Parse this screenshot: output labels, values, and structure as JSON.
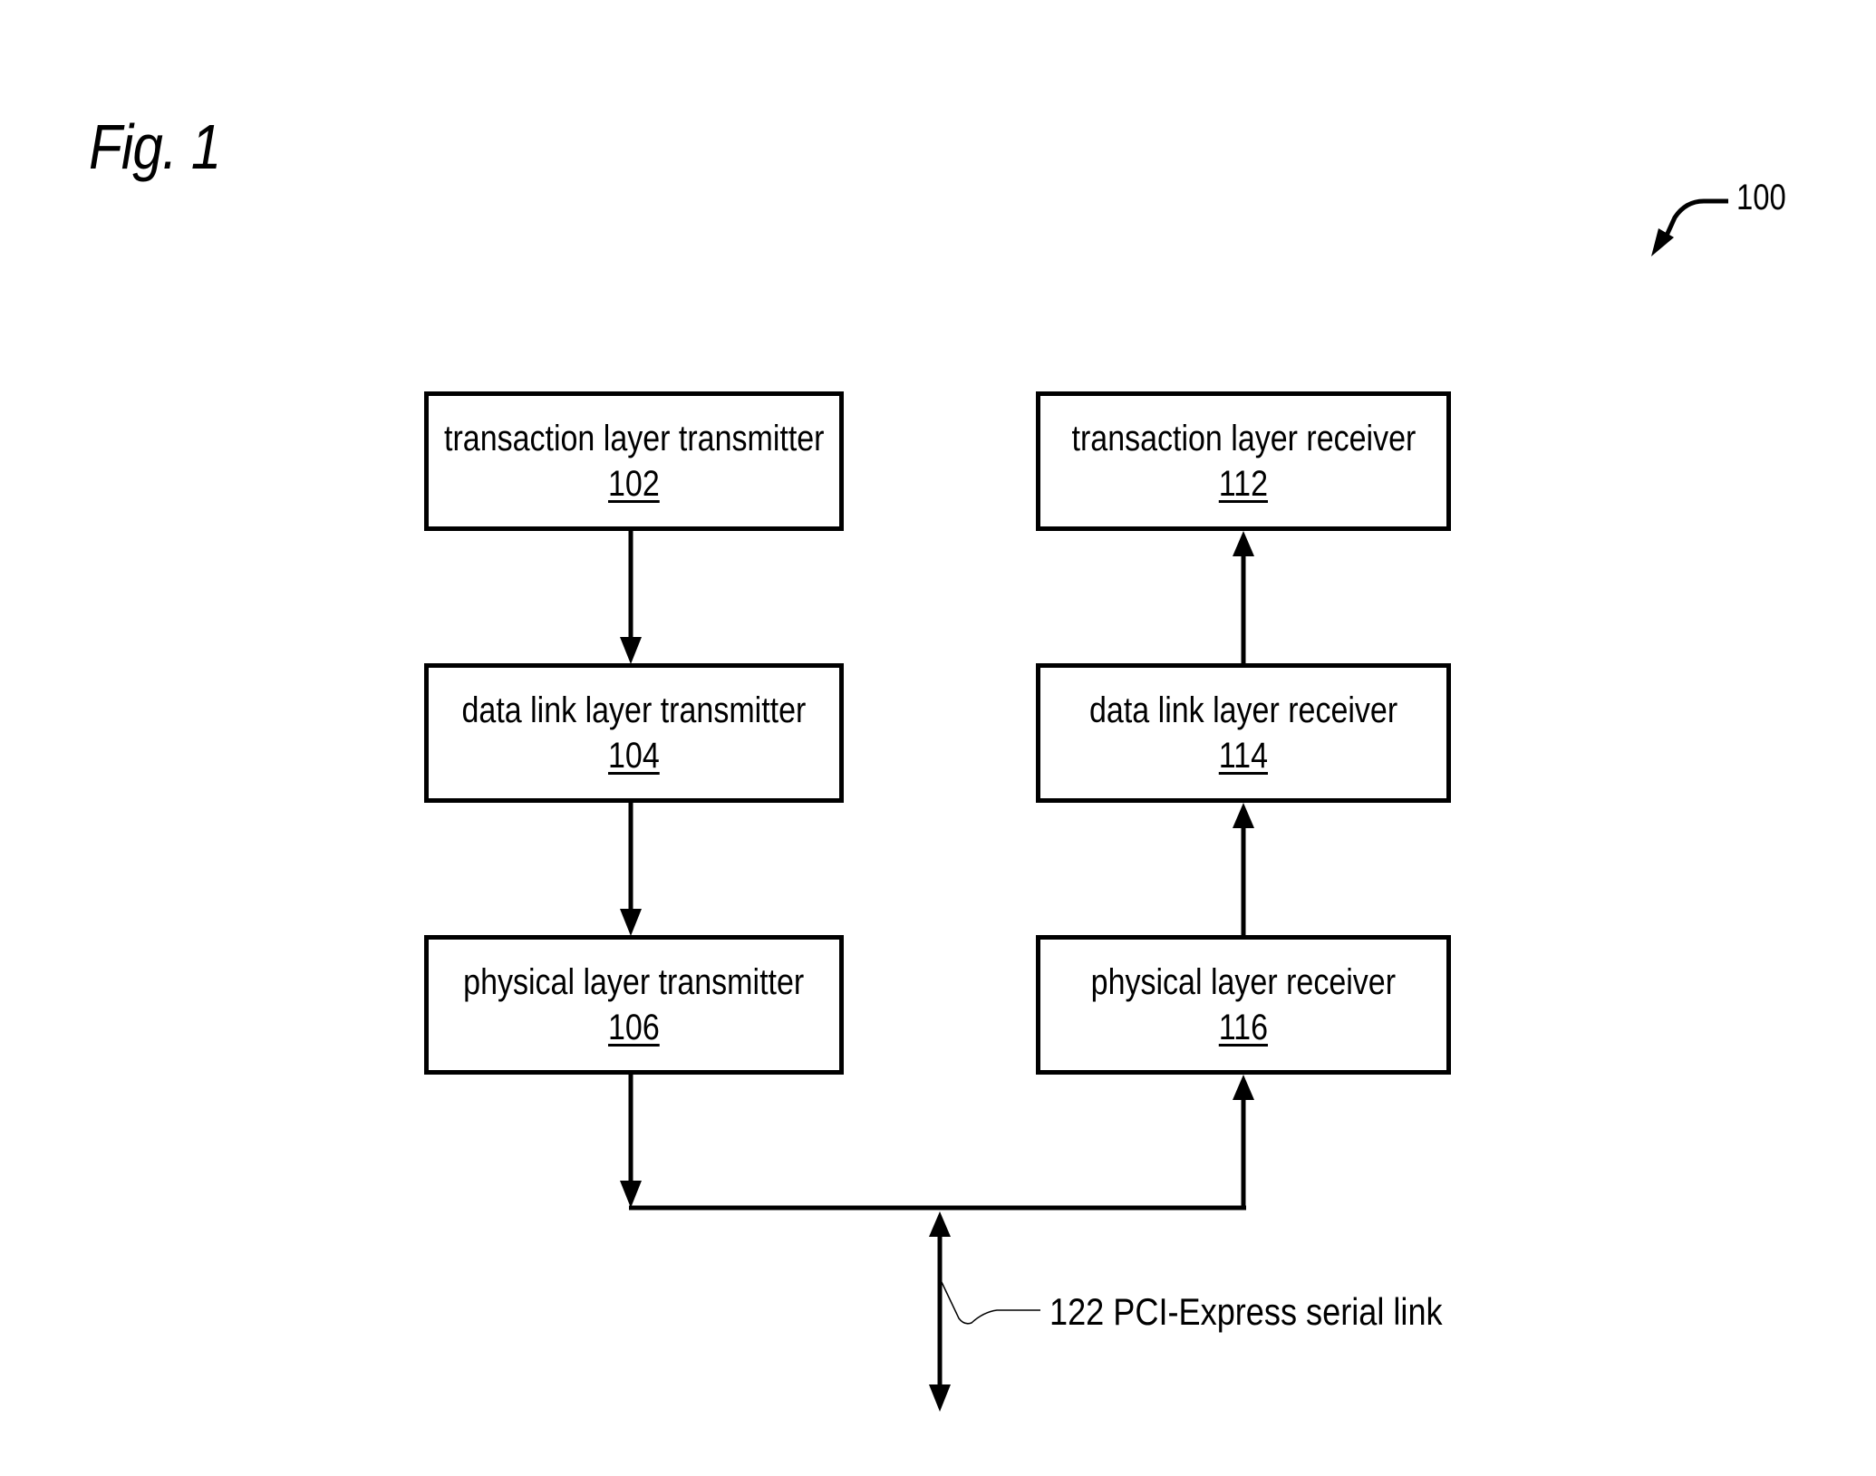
{
  "figure": {
    "title": "Fig. 1",
    "reference": "100"
  },
  "blocks": {
    "tl_tx": {
      "label": "transaction layer transmitter",
      "number": "102"
    },
    "dl_tx": {
      "label": "data link layer transmitter",
      "number": "104"
    },
    "ph_tx": {
      "label": "physical layer transmitter",
      "number": "106"
    },
    "tl_rx": {
      "label": "transaction layer receiver",
      "number": "112"
    },
    "dl_rx": {
      "label": "data link layer receiver",
      "number": "114"
    },
    "ph_rx": {
      "label": "physical layer receiver",
      "number": "116"
    }
  },
  "link": {
    "label": "122 PCI-Express serial link"
  },
  "connections": [
    {
      "from": "102",
      "to": "104",
      "direction": "down"
    },
    {
      "from": "104",
      "to": "106",
      "direction": "down"
    },
    {
      "from": "106",
      "to": "122",
      "direction": "down"
    },
    {
      "from": "122",
      "to": "116",
      "direction": "up"
    },
    {
      "from": "116",
      "to": "114",
      "direction": "up"
    },
    {
      "from": "114",
      "to": "112",
      "direction": "up"
    }
  ]
}
